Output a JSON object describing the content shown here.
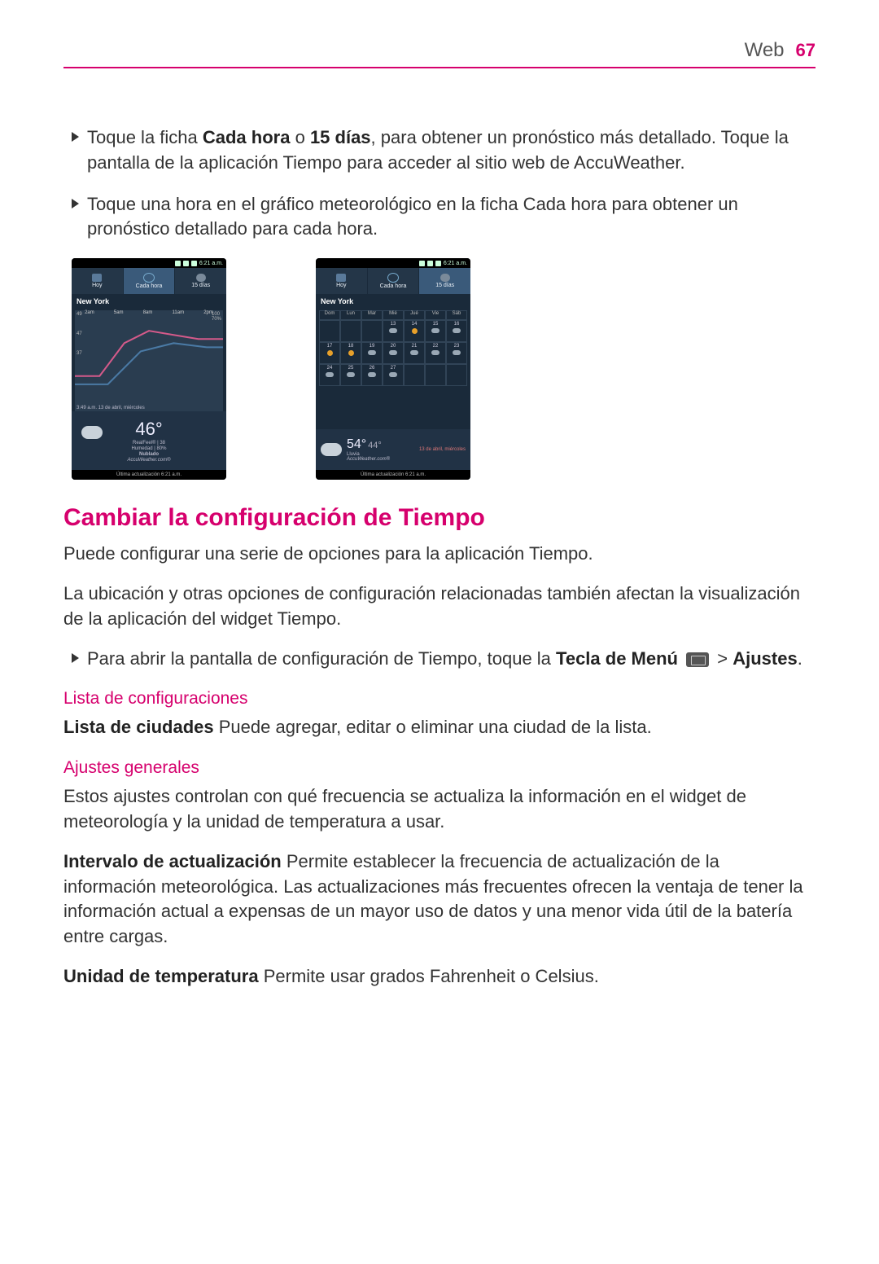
{
  "header": {
    "title": "Web",
    "page": "67"
  },
  "bullets": [
    {
      "pre": "Toque la ficha ",
      "b1": "Cada hora",
      "mid": " o ",
      "b2": "15 días",
      "post": ", para obtener un pronóstico más detallado. Toque la pantalla de la aplicación Tiempo para acceder al sitio web de AccuWeather."
    },
    {
      "pre": "Toque una hora en el gráfico meteorológico en la ficha Cada hora para obtener un pronóstico detallado para cada hora."
    }
  ],
  "phone": {
    "statusTime": "6:21 a.m.",
    "tabs": {
      "hoy": "Hoy",
      "cadaHora": "Cada hora",
      "dias": "15 días"
    },
    "city": "New York",
    "hourly": {
      "hours": [
        "2am",
        "5am",
        "8am",
        "11am",
        "2pm"
      ],
      "yRight": [
        "100",
        "70%"
      ],
      "yLeft": [
        "49",
        "47",
        "37"
      ],
      "timestamp": "3:49 a.m. 13 de abril, miércoles",
      "bigTemp": "46°",
      "realfeel": "RealFeel® | 38",
      "hum": "Humedad | 80%",
      "cond": "Nublado",
      "brand": "AccuWeather.com®"
    },
    "daily": {
      "dow": [
        "Dom",
        "Lun",
        "Mar",
        "Mié",
        "Jué",
        "Vie",
        "Sáb"
      ],
      "grid": [
        [
          "",
          "",
          "",
          "13",
          "14",
          "15",
          "16"
        ],
        [
          "17",
          "18",
          "19",
          "20",
          "21",
          "22",
          "23"
        ],
        [
          "24",
          "25",
          "26",
          "27",
          "",
          "",
          ""
        ]
      ],
      "dateLabel": "13 de abril, miércoles",
      "temp": "54°",
      "temp2": "44°",
      "cond": "Lluvia",
      "brand": "AccuWeather.com®"
    },
    "footer": "Última actualización 6:21 a.m."
  },
  "section": {
    "title": "Cambiar la configuración de Tiempo",
    "p1": "Puede configurar una serie de opciones para la aplicación Tiempo.",
    "p2": "La ubicación y otras opciones de configuración relacionadas también afectan la visualización de la aplicación del widget Tiempo.",
    "b3pre": "Para abrir la pantalla de configuración de Tiempo, toque la ",
    "b3bold": "Tecla de Menú",
    "b3post1": " ",
    "b3post2": " > ",
    "b3bold2": "Ajustes",
    "b3post3": "."
  },
  "lista": {
    "title": "Lista de configuraciones",
    "bold": "Lista de ciudades",
    "txt": " Puede agregar, editar o eliminar una ciudad de la lista."
  },
  "ajustes": {
    "title": "Ajustes generales",
    "p1": "Estos ajustes controlan con qué frecuencia se actualiza la información en el widget de meteorología y la unidad de temperatura a usar.",
    "b1": "Intervalo de actualización",
    "t1": " Permite establecer la frecuencia de actualización de la información meteorológica. Las actualizaciones más frecuentes ofrecen la ventaja de tener la información actual a expensas de un mayor uso de datos y una menor vida útil de la batería entre cargas.",
    "b2": "Unidad de temperatura",
    "t2": " Permite usar grados Fahrenheit o Celsius."
  }
}
